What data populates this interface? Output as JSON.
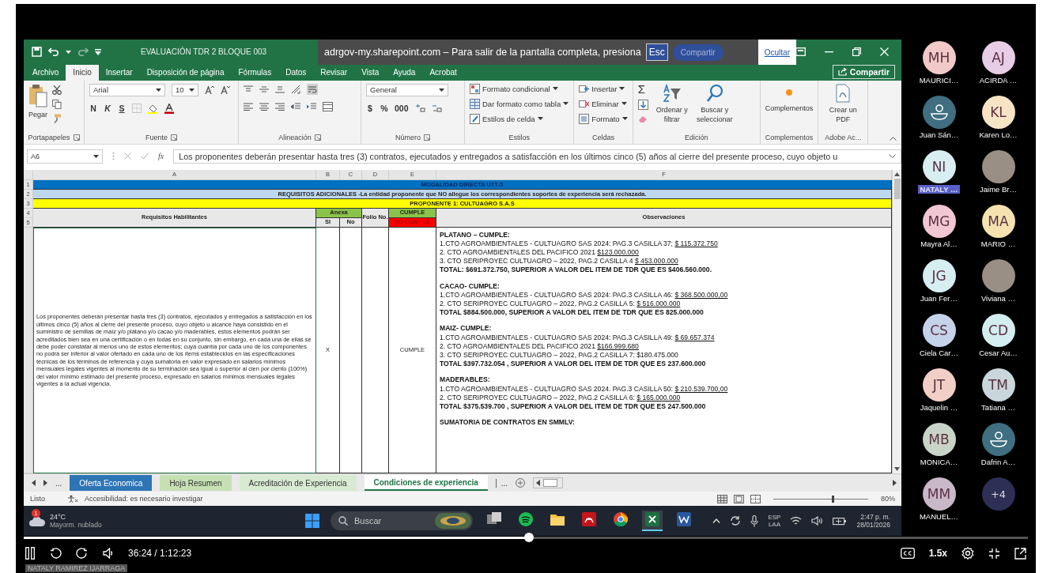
{
  "excel": {
    "title": "EVALUACIÓN TDR 2 BLOQUE 003",
    "notice": {
      "text": "adrgov-my.sharepoint.com – Para salir de la pantalla completa, presiona",
      "key": "Esc",
      "button": "Compartir",
      "link": "Ocultar"
    },
    "tabs": [
      {
        "label": "Archivo",
        "selected": false
      },
      {
        "label": "Inicio",
        "selected": true
      },
      {
        "label": "Insertar",
        "selected": false
      },
      {
        "label": "Disposición de página",
        "selected": false
      },
      {
        "label": "Fórmulas",
        "selected": false
      },
      {
        "label": "Datos",
        "selected": false
      },
      {
        "label": "Revisar",
        "selected": false
      },
      {
        "label": "Vista",
        "selected": false
      },
      {
        "label": "Ayuda",
        "selected": false
      },
      {
        "label": "Acrobat",
        "selected": false
      }
    ],
    "share": "Compartir",
    "ribbon": [
      {
        "label": "Portapapeles",
        "kind": "clipboard",
        "items": [
          "Pegar"
        ]
      },
      {
        "label": "Fuente",
        "kind": "font",
        "font": "Arial",
        "size": "10",
        "items": [
          "N",
          "K",
          "S"
        ]
      },
      {
        "label": "Alineación",
        "kind": "align"
      },
      {
        "label": "Número",
        "kind": "number",
        "format": "General",
        "items": [
          "$",
          "%",
          "000"
        ]
      },
      {
        "label": "Estilos",
        "kind": "list",
        "items": [
          "Formato condicional",
          "Dar formato como tabla",
          "Estilos de celda"
        ]
      },
      {
        "label": "Celdas",
        "kind": "list",
        "items": [
          "Insertar",
          "Eliminar",
          "Formato"
        ]
      },
      {
        "label": "Edición",
        "kind": "edit",
        "sum": "Σ",
        "items": [
          "Ordenar y filtrar",
          "Buscar y seleccionar"
        ]
      },
      {
        "label": "Complementos",
        "kind": "big",
        "items": [
          "Complementos"
        ]
      },
      {
        "label": "Adobe Ac...",
        "kind": "big",
        "items": [
          "Crear un PDF"
        ]
      }
    ],
    "formula_bar": {
      "cell": "A6",
      "fx": "fx",
      "formula": "Los proponentes deberán presentar hasta tres (3) contratos, ejecutados y entregados a satisfacción en los últimos cinco (5) años al cierre del presente proceso, cuyo objeto u"
    },
    "sheet": {
      "columns": [
        "A",
        "B",
        "C",
        "D",
        "E",
        "F"
      ],
      "banners": [
        {
          "row": "1",
          "text": "MODALIDAD DIRECTA UTT-5",
          "color": "#0070c0"
        },
        {
          "row": "2",
          "text": "REQUISITOS ADICIONALES -La entidad proponente que NO allegue los correspondientes soportes de experiencia será rechazada.",
          "color": "#bdd7ee"
        },
        {
          "row": "3",
          "text": "PROPONENTE 1: CULTUAGRO S.A.S",
          "color": "#ffff00"
        }
      ],
      "header": {
        "rows": [
          "4",
          "5"
        ],
        "requisitos": "Requisitos Habilitantes",
        "anexa": "Anexa",
        "si": "SI",
        "no": "No",
        "folio": "Folio No.",
        "cumple": "CUMPLE",
        "no_cumple": "NO CUMPLE",
        "observaciones": "Observaciones"
      },
      "row": {
        "requisito": "Los proponentes deberán presentar hasta tres (3) contratos, ejecutados y entregados a satisfacción en los últimos cinco (5) años al cierre del presente proceso, cuyo objeto u alcance haya consistido en el suministro de semillas de maíz y/o plátano y/o cacao y/o maderables, estos elementos podrán ser acreditados bien sea en una certificación o en todas en su conjunto, sin embargo, en cada una de ellas se debe poder constatar al menos uno de estos elementos; cuya cuantía por cada uno de los componentes no podrá ser inferior al valor ofertado en cada uno de los ítems establecidos en las especificaciones técnicas de los términos de referencia y cuya sumatoria en valor expresado en salarios mínimos mensuales legales vigentes al momento de su terminación sea igual o superior al cien por ciento (100%) del valor mínimo estimado del presente proceso, expresado en salarios mínimos mensuales legales vigentes a la actual vigencia.",
        "si": "X",
        "cumple": "CUMPLE",
        "observations": [
          {
            "heading": "PLATANO – CUMPLE:",
            "items": [
              {
                "text": "1.CTO AGROAMBIENTALES - CULTUAGRO SAS 2024: PAG.3 CASILLA 37;",
                "amount": "$ 115.372.750"
              },
              {
                "text": "2. CTO AGROAMBIENTALES DEL PACIFICO 2021",
                "amount": "$123.000.000"
              },
              {
                "text": "3. CTO SERIPROYEC CULTUAGRO – 2022, PAG.2 CASILLA 4",
                "amount": "$ 453.000.000"
              }
            ],
            "total": "TOTAL: $691.372.750, SUPERIOR A VALOR DEL ITEM DE TDR QUE ES $406.560.000."
          },
          {
            "heading": "CACAO- CUMPLE:",
            "items": [
              {
                "text": "1.CTO AGROAMBIENTALES - CULTUAGRO SAS 2024: PAG.3 CASILLA 46:",
                "amount": "$ 368.500.000,00"
              },
              {
                "text": "2. CTO SERIPROYEC CULTUAGRO – 2022, PAG.2 CASILLA 5:",
                "amount": "$ 516.000.000"
              }
            ],
            "total": "TOTAL $884.500.000, SUPERIOR A VALOR DEL ITEM DE TDR QUE ES 825.000.000"
          },
          {
            "heading": "MAIZ- CUMPLE:",
            "items": [
              {
                "text": "1.CTO AGROAMBIENTALES - CULTUAGRO SAS 2024: PAG.3 CASILLA 49:",
                "amount": "$ 69.657.374"
              },
              {
                "text": "2.  CTO AGROAMBIENTALES DEL PACIFICO 2021",
                "amount": "$166.999.680"
              },
              {
                "text": "3. CTO SERIPROYEC CULTUAGRO – 2022, PAG.2 CASILLA 7: $180.475.000"
              }
            ],
            "total": "TOTAL $397.732.054 ,  SUPERIOR A VALOR DEL ITEM DE TDR QUE ES 237.600.000"
          },
          {
            "heading": "MADERABLES:",
            "items": [
              {
                "text": "1.CTO AGROAMBIENTALES - CULTUAGRO SAS 2024. PAG.3 CASILLA 50:",
                "amount": "$ 210.539.700,00"
              },
              {
                "text": "2. CTO SERIPROYEC CULTUAGRO – 2022, PAG.2 CASILLA 6:",
                "amount": "$ 165.000.000"
              }
            ],
            "total": "TOTAL $375.539.700 ,  SUPERIOR A VALOR DEL ITEM DE TDR QUE ES 247.500.000"
          },
          {
            "heading": "SUMATORIA DE CONTRATOS EN SMMLV:"
          }
        ]
      }
    },
    "sheet_tabs": {
      "more_before": "...",
      "more_after": "...",
      "tabs": [
        {
          "label": "Oferta Economica",
          "color": "#2e75b6",
          "selected": false
        },
        {
          "label": "Hoja Resumen",
          "color": "#c6e0b4",
          "selected": false
        },
        {
          "label": "Acreditación de Experiencia",
          "color": "#d9ead3",
          "selected": false
        },
        {
          "label": "Condiciones de experiencia",
          "color": "#ffffff",
          "selected": true
        }
      ]
    },
    "status_bar": {
      "ready": "Listo",
      "accessibility": "Accesibilidad: es necesario investigar",
      "zoom": "80%",
      "zoom_slider": {
        "level": 0.62
      }
    }
  },
  "taskbar": {
    "weather_badge": "1",
    "temperature": "24°C",
    "weather": "Mayorm. nublado",
    "search": "Buscar",
    "apps": [
      {
        "kind": "taskview",
        "active": false
      },
      {
        "kind": "spotify",
        "active": false
      },
      {
        "kind": "folder",
        "active": false
      },
      {
        "kind": "pdf",
        "active": false
      },
      {
        "kind": "chrome",
        "active": false
      },
      {
        "kind": "excel",
        "active": true
      },
      {
        "kind": "word",
        "active": false
      }
    ],
    "language": "ESP",
    "layout": "LAA",
    "time": "2:47 p. m.",
    "date": "28/01/2026"
  },
  "participant_rows": [
    [
      {
        "kind": "initials",
        "initials": "MH",
        "name": "MAURICI…",
        "color": "#f2c9c9",
        "highlighted": false
      },
      {
        "kind": "initials",
        "initials": "AJ",
        "name": "ACIRDA …",
        "color": "#e8cde6",
        "highlighted": false
      }
    ],
    [
      {
        "kind": "generic",
        "name": "Juan Sán…",
        "color": "#3f6f80",
        "highlighted": false
      },
      {
        "kind": "initials",
        "initials": "KL",
        "name": "Karen Lo…",
        "color": "#f7e4c4",
        "highlighted": false
      }
    ],
    [
      {
        "kind": "initials",
        "initials": "NI",
        "name": "NATALY …",
        "color": "#d8eef0",
        "highlighted": true
      },
      {
        "kind": "photo",
        "name": "Jaime Br…",
        "highlighted": false
      }
    ],
    [
      {
        "kind": "initials",
        "initials": "MG",
        "name": "Mayra Al…",
        "color": "#f2c7d4",
        "highlighted": false
      },
      {
        "kind": "initials",
        "initials": "MA",
        "name": "MARIO …",
        "color": "#f4e3b0",
        "highlighted": false
      }
    ],
    [
      {
        "kind": "initials",
        "initials": "JG",
        "name": "Juan Fer…",
        "color": "#d6eef2",
        "highlighted": false
      },
      {
        "kind": "photo",
        "name": "Viviana …",
        "highlighted": false
      }
    ],
    [
      {
        "kind": "initials",
        "initials": "CS",
        "name": "Ciela Car…",
        "color": "#c5d3ea",
        "highlighted": false
      },
      {
        "kind": "initials",
        "initials": "CD",
        "name": "Cesar Au…",
        "color": "#d4eef0",
        "highlighted": false
      }
    ],
    [
      {
        "kind": "initials",
        "initials": "JT",
        "name": "Jaquelin …",
        "color": "#f2cfc6",
        "highlighted": false
      },
      {
        "kind": "initials",
        "initials": "TM",
        "name": "Tatiana …",
        "color": "#c9d6dc",
        "highlighted": false
      }
    ],
    [
      {
        "kind": "initials",
        "initials": "MB",
        "name": "MONICA…",
        "color": "#c9d4c8",
        "highlighted": false
      },
      {
        "kind": "generic",
        "name": "Dafrin A…",
        "color": "#3f6f80",
        "highlighted": false
      }
    ],
    [
      {
        "kind": "initials",
        "initials": "MM",
        "name": "MANUEL…",
        "color": "#c9b8c8",
        "highlighted": false
      },
      {
        "kind": "more",
        "initials": "+4",
        "color": "#2e2f55"
      }
    ]
  ],
  "player": {
    "level": 0.503,
    "time": "36:24 / 1:12:23",
    "speed": "1.5x",
    "speaker": "NATALY RAMIREZ IJARRAGA"
  }
}
